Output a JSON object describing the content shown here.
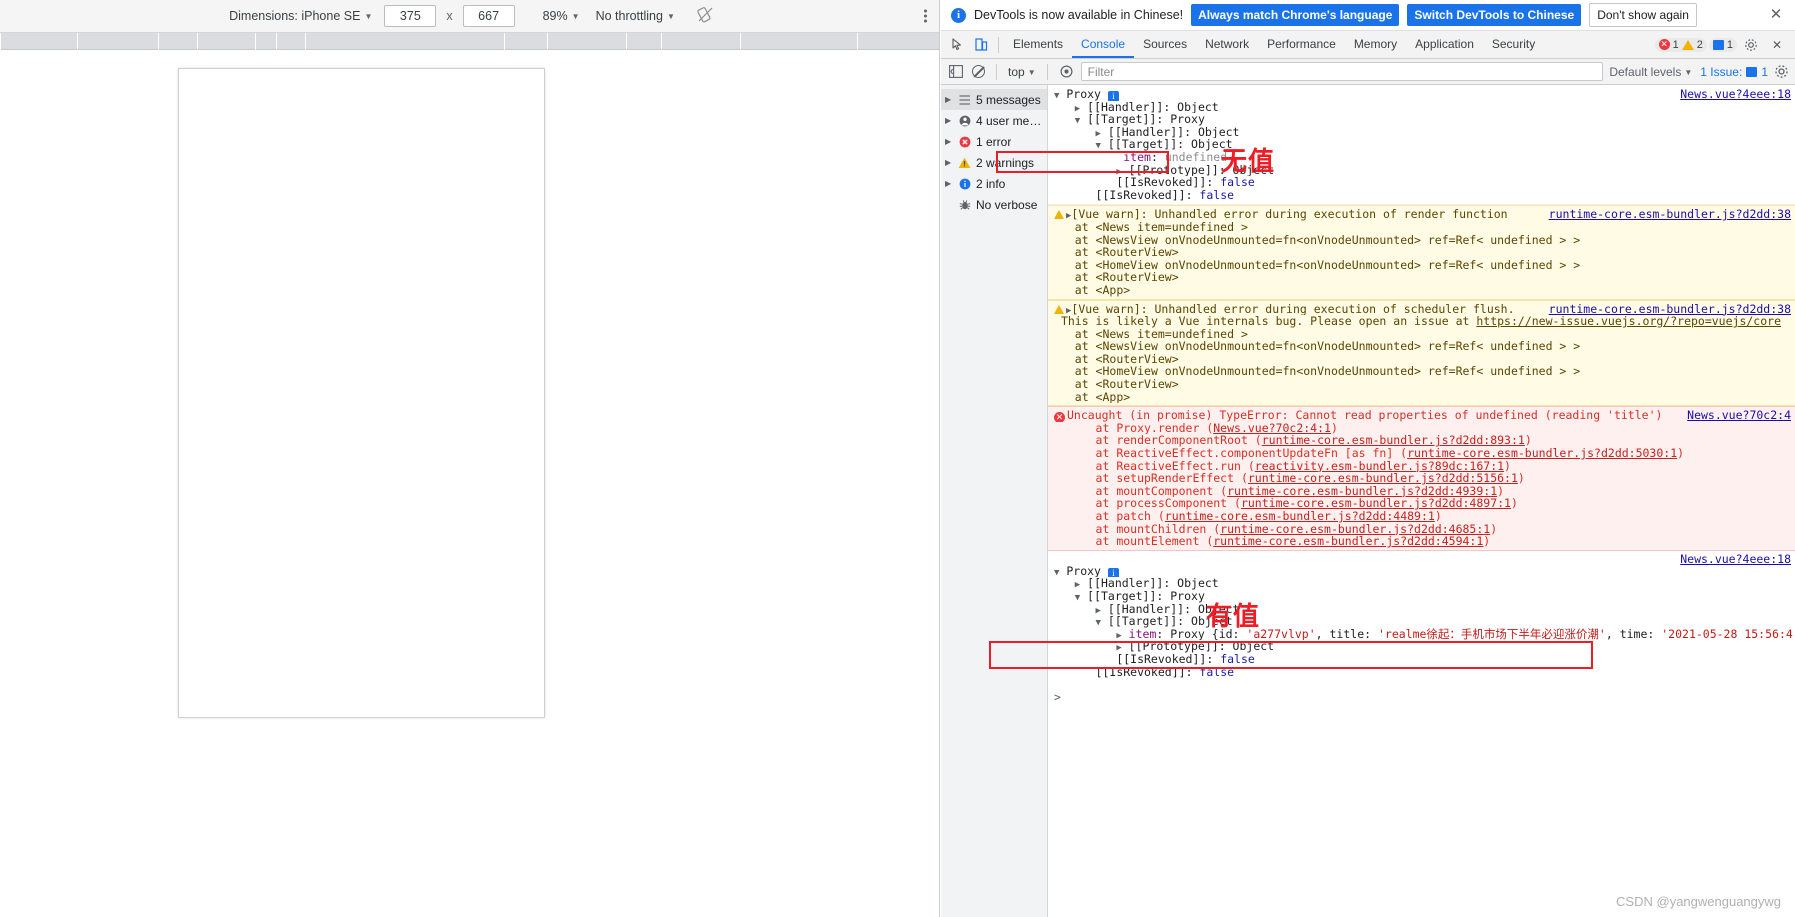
{
  "device_toolbar": {
    "dimensions_label": "Dimensions: iPhone SE",
    "width_value": "375",
    "times": "x",
    "height_value": "667",
    "zoom_value": "89%",
    "throttling_value": "No throttling",
    "rotate_icon": "rotate-icon",
    "more_options_icon": "kebab-menu-icon"
  },
  "locale_banner": {
    "info_icon": "info-icon",
    "message": "DevTools is now available in Chinese!",
    "always_match_label": "Always match Chrome's language",
    "switch_label": "Switch DevTools to Chinese",
    "dont_show_label": "Don't show again",
    "close_icon": "close-icon"
  },
  "tabstrip": {
    "inspect_icon": "inspect-cursor-icon",
    "device_toggle_icon": "device-toolbar-icon",
    "tabs": [
      {
        "label": "Elements",
        "active": false
      },
      {
        "label": "Console",
        "active": true
      },
      {
        "label": "Sources",
        "active": false
      },
      {
        "label": "Network",
        "active": false
      },
      {
        "label": "Performance",
        "active": false
      },
      {
        "label": "Memory",
        "active": false
      },
      {
        "label": "Application",
        "active": false
      },
      {
        "label": "Security",
        "active": false
      }
    ],
    "error_count": "1",
    "warning_count": "2",
    "issue_count": "1",
    "settings_icon": "gear-icon",
    "close_icon": "close-devtools-icon"
  },
  "filterbar": {
    "sidebar_toggle_icon": "show-console-sidebar-icon",
    "clear_icon": "clear-console-icon",
    "context_value": "top",
    "eye_icon": "live-expression-icon",
    "filter_placeholder": "Filter",
    "filter_value": "",
    "levels_value": "Default levels",
    "issues_label": "1 Issue:",
    "issues_count": "1",
    "settings_icon": "console-settings-icon"
  },
  "console_sidebar": [
    {
      "label": "5 messages",
      "icon": "list-icon",
      "selected": true
    },
    {
      "label": "4 user mess…",
      "icon": "user-icon",
      "selected": false
    },
    {
      "label": "1 error",
      "icon": "error-icon",
      "selected": false
    },
    {
      "label": "2 warnings",
      "icon": "warning-icon",
      "selected": false
    },
    {
      "label": "2 info",
      "icon": "info-icon",
      "selected": false
    },
    {
      "label": "No verbose",
      "icon": "bug-icon",
      "selected": false
    }
  ],
  "annotations": {
    "no_value_label": "无值",
    "has_value_label": "有值"
  },
  "messages": {
    "proxy_top": {
      "anchor": "News.vue?4eee:18",
      "lines": [
        "▼ Proxy ⓘ",
        "  ▶ [[Handler]]: Object",
        "  ▼ [[Target]]: Proxy",
        "    ▶ [[Handler]]: Object",
        "    ▼ [[Target]]: Object",
        "        item: undefined",
        "      ▶ [[Prototype]]: Object",
        "      [[IsRevoked]]: false",
        "    [[IsRevoked]]: false"
      ]
    },
    "warn1": {
      "head": "[Vue warn]: Unhandled error during execution of render function",
      "anchor": "runtime-core.esm-bundler.js?d2dd:38",
      "stack": [
        "at <News item=undefined >",
        "at <NewsView onVnodeUnmounted=fn<onVnodeUnmounted> ref=Ref< undefined > >",
        "at <RouterView>",
        "at <HomeView onVnodeUnmounted=fn<onVnodeUnmounted> ref=Ref< undefined > >",
        "at <RouterView>",
        "at <App>"
      ]
    },
    "warn2": {
      "head": "[Vue warn]: Unhandled error during execution of scheduler flush.",
      "anchor": "runtime-core.esm-bundler.js?d2dd:38",
      "subhead_pre": "This is likely a Vue internals bug. Please open an issue at ",
      "subhead_link": "https://new-issue.vuejs.org/?repo=vuejs/core",
      "stack": [
        "at <News item=undefined >",
        "at <NewsView onVnodeUnmounted=fn<onVnodeUnmounted> ref=Ref< undefined > >",
        "at <RouterView>",
        "at <HomeView onVnodeUnmounted=fn<onVnodeUnmounted> ref=Ref< undefined > >",
        "at <RouterView>",
        "at <App>"
      ]
    },
    "error": {
      "head": "Uncaught (in promise) TypeError: Cannot read properties of undefined (reading 'title')",
      "anchor": "News.vue?70c2:4",
      "frames": [
        {
          "fn": "at Proxy.render (",
          "link": "News.vue?70c2:4:1",
          "tail": ")"
        },
        {
          "fn": "at renderComponentRoot (",
          "link": "runtime-core.esm-bundler.js?d2dd:893:1",
          "tail": ")"
        },
        {
          "fn": "at ReactiveEffect.componentUpdateFn [as fn] (",
          "link": "runtime-core.esm-bundler.js?d2dd:5030:1",
          "tail": ")"
        },
        {
          "fn": "at ReactiveEffect.run (",
          "link": "reactivity.esm-bundler.js?89dc:167:1",
          "tail": ")"
        },
        {
          "fn": "at setupRenderEffect (",
          "link": "runtime-core.esm-bundler.js?d2dd:5156:1",
          "tail": ")"
        },
        {
          "fn": "at mountComponent (",
          "link": "runtime-core.esm-bundler.js?d2dd:4939:1",
          "tail": ")"
        },
        {
          "fn": "at processComponent (",
          "link": "runtime-core.esm-bundler.js?d2dd:4897:1",
          "tail": ")"
        },
        {
          "fn": "at patch (",
          "link": "runtime-core.esm-bundler.js?d2dd:4489:1",
          "tail": ")"
        },
        {
          "fn": "at mountChildren (",
          "link": "runtime-core.esm-bundler.js?d2dd:4685:1",
          "tail": ")"
        },
        {
          "fn": "at mountElement (",
          "link": "runtime-core.esm-bundler.js?d2dd:4594:1",
          "tail": ")"
        }
      ]
    },
    "proxy_bottom": {
      "anchor": "News.vue?4eee:18",
      "l1": "▼ Proxy ⓘ",
      "l2": "  ▶ [[Handler]]: Object",
      "l3": "  ▼ [[Target]]: Proxy",
      "l4": "    ▶ [[Handler]]: Object",
      "l5": "    ▼ [[Target]]: Object",
      "item_prefix": "      ▶ item: Proxy {id: ",
      "item_id": "'a277vlvp'",
      "item_mid": ", title: ",
      "item_title": "'realme徐起：手机市场下半年必迎涨价潮'",
      "item_mid2": ", time: ",
      "item_time": "'2021-05-28 15:56:4",
      "l7": "      ▶ [[Prototype]]: Object",
      "l8": "      [[IsRevoked]]: false",
      "l9": "    [[IsRevoked]]: false"
    },
    "prompt": ">"
  },
  "watermark": "CSDN @yangwenguangywg"
}
